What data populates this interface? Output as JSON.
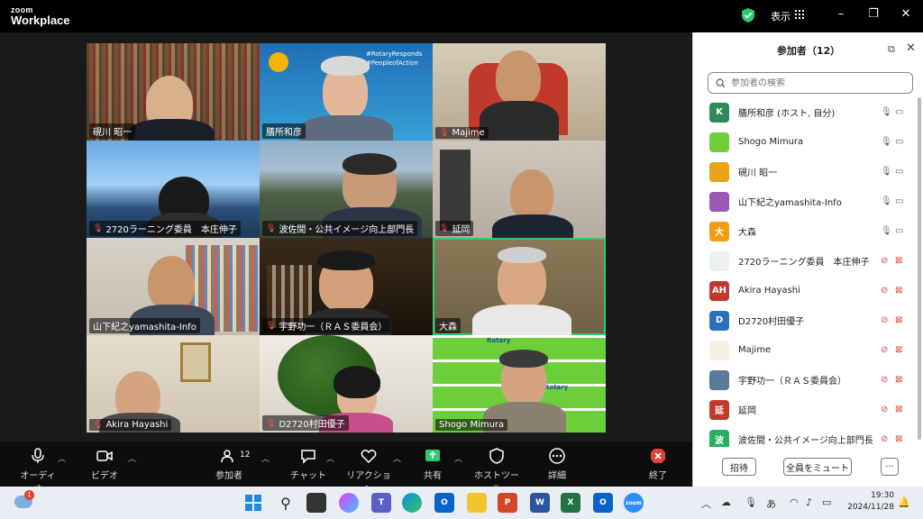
{
  "app": {
    "brand_top": "zoom",
    "brand_main": "Workplace",
    "view_label": "表示"
  },
  "tiles": [
    {
      "name": "硯川 昭一",
      "muted": false
    },
    {
      "name": "膳所和彦",
      "muted": false
    },
    {
      "name": "Majime",
      "muted": true
    },
    {
      "name": "2720ラーニング委員　本庄伸子",
      "muted": true
    },
    {
      "name": "波佐間・公共イメージ向上部門長",
      "muted": true
    },
    {
      "name": "延岡",
      "muted": true
    },
    {
      "name": "山下紀之yamashita-Info",
      "muted": false
    },
    {
      "name": "宇野功一（ＲＡＳ委員会）",
      "muted": true
    },
    {
      "name": "大森",
      "muted": false
    },
    {
      "name": "Akira Hayashi",
      "muted": true
    },
    {
      "name": "D2720村田優子",
      "muted": true
    },
    {
      "name": "Shogo Mimura",
      "muted": false
    }
  ],
  "bg_text": {
    "hashtag1": "#RotaryResponds",
    "hashtag2": "#PeopleofAction",
    "rotary": "Rotary"
  },
  "toolbar": {
    "audio": "オーディオ",
    "video": "ビデオ",
    "participants": "参加者",
    "participants_count": "12",
    "chat": "チャット",
    "reactions": "リアクション",
    "share": "共有",
    "host_tools": "ホストツール",
    "more": "詳細",
    "end": "終了"
  },
  "panel": {
    "title": "参加者（12）",
    "search_placeholder": "参加者の検索",
    "participants": [
      {
        "initials": "K",
        "color": "#2e8b57",
        "name": "膳所和彦 (ホスト, 自分)",
        "mic_on": true,
        "cam_off": false
      },
      {
        "initials": "",
        "color": "#6fcf3a",
        "name": "Shogo Mimura",
        "mic_on": true,
        "cam_off": false
      },
      {
        "initials": "",
        "color": "#e8a317",
        "name": "硯川 昭一",
        "mic_on": true,
        "cam_off": false
      },
      {
        "initials": "",
        "color": "#9b59b6",
        "name": "山下紀之yamashita-Info",
        "mic_on": true,
        "cam_off": false
      },
      {
        "initials": "大",
        "color": "#f39c12",
        "name": "大森",
        "mic_on": true,
        "cam_off": false
      },
      {
        "initials": "",
        "color": "#ecf0f1",
        "name": "2720ラーニング委員　本庄伸子",
        "mic_on": false,
        "cam_off": true
      },
      {
        "initials": "AH",
        "color": "#c0392b",
        "name": "Akira Hayashi",
        "mic_on": false,
        "cam_off": true
      },
      {
        "initials": "D",
        "color": "#2c6fbb",
        "name": "D2720村田優子",
        "mic_on": false,
        "cam_off": true
      },
      {
        "initials": "",
        "color": "#f5f0e0",
        "name": "Majime",
        "mic_on": false,
        "cam_off": true
      },
      {
        "initials": "",
        "color": "#5a7a9a",
        "name": "宇野功一（ＲＡＳ委員会）",
        "mic_on": false,
        "cam_off": true
      },
      {
        "initials": "延",
        "color": "#c0392b",
        "name": "延岡",
        "mic_on": false,
        "cam_off": true
      },
      {
        "initials": "波",
        "color": "#27ae60",
        "name": "波佐間・公共イメージ向上部門長",
        "mic_on": false,
        "cam_off": true
      }
    ],
    "invite": "招待",
    "mute_all": "全員をミュート",
    "more": "···"
  },
  "taskbar": {
    "time": "19:30",
    "date": "2024/11/28",
    "ime": "あ",
    "notif_count": "1",
    "zoom_label": "zoom"
  }
}
